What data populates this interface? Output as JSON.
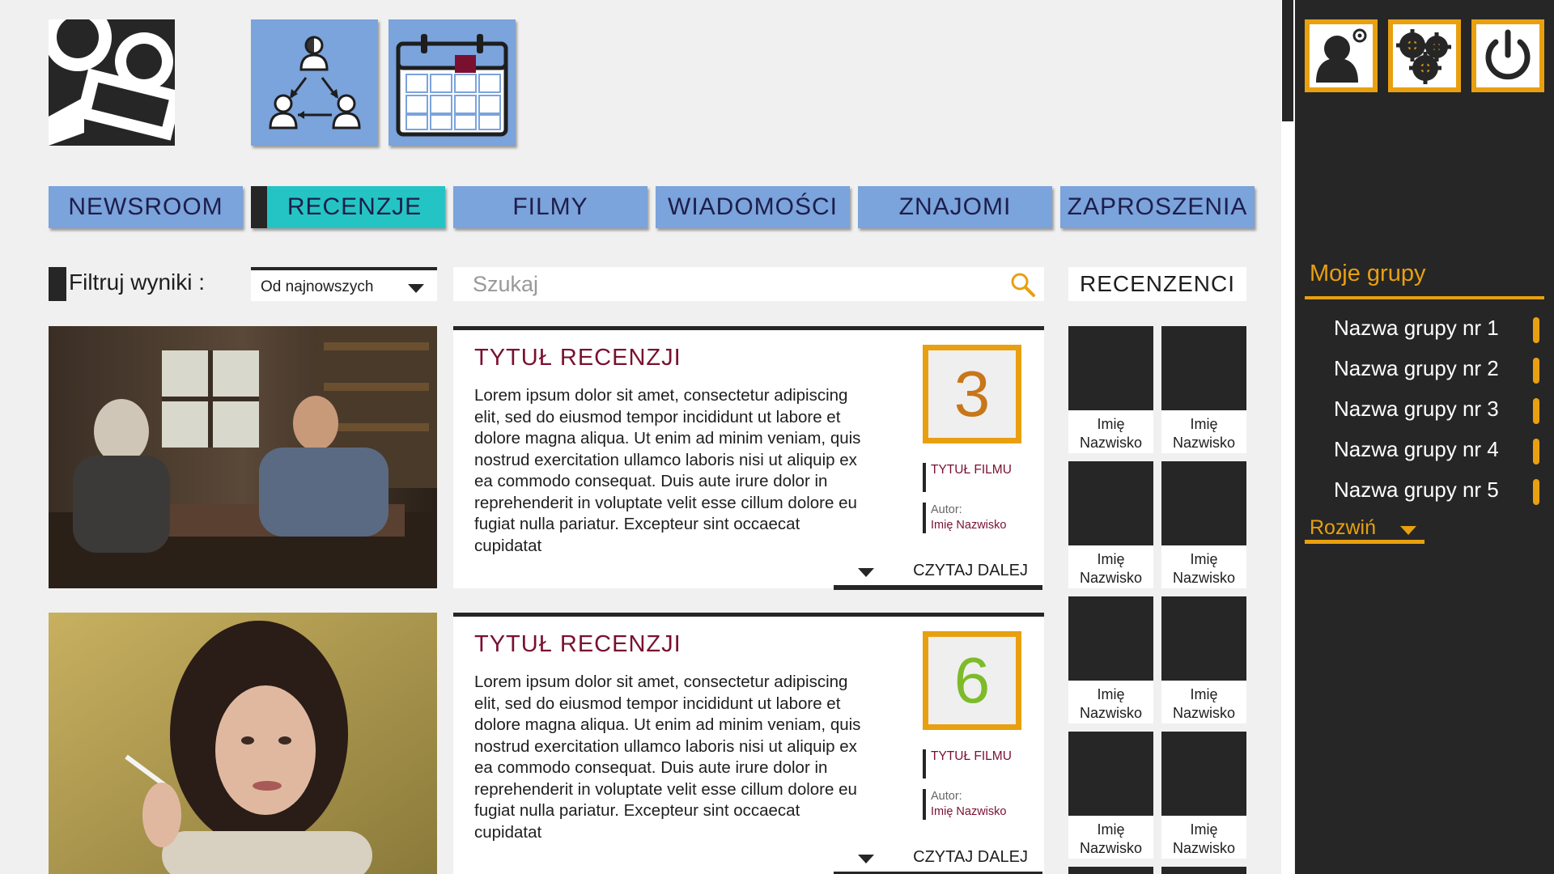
{
  "topbar": {
    "logo_icon": "film-camera-logo-icon",
    "friends_network_icon": "friends-network-icon",
    "calendar_icon": "calendar-icon"
  },
  "nav": {
    "items": [
      {
        "label": "NEWSROOM",
        "active": false
      },
      {
        "label": "RECENZJE",
        "active": true
      },
      {
        "label": "FILMY",
        "active": false
      },
      {
        "label": "WIADOMOŚCI",
        "active": false
      },
      {
        "label": "ZNAJOMI",
        "active": false
      },
      {
        "label": "ZAPROSZENIA",
        "active": false
      }
    ]
  },
  "filter": {
    "label": "Filtruj wyniki :",
    "selected": "Od najnowszych"
  },
  "search": {
    "placeholder": "Szukaj"
  },
  "reviewers": {
    "title": "RECENZENCI",
    "items": [
      {
        "first": "Imię",
        "last": "Nazwisko"
      },
      {
        "first": "Imię",
        "last": "Nazwisko"
      },
      {
        "first": "Imię",
        "last": "Nazwisko"
      },
      {
        "first": "Imię",
        "last": "Nazwisko"
      },
      {
        "first": "Imię",
        "last": "Nazwisko"
      },
      {
        "first": "Imię",
        "last": "Nazwisko"
      },
      {
        "first": "Imię",
        "last": "Nazwisko"
      },
      {
        "first": "Imię",
        "last": "Nazwisko"
      }
    ]
  },
  "reviews": [
    {
      "title": "TYTUŁ RECENZJI",
      "body": "Lorem ipsum dolor sit amet, consectetur adipiscing elit, sed do eiusmod tempor incididunt ut labore et dolore magna aliqua. Ut enim ad minim veniam, quis nostrud exercitation ullamco laboris nisi ut aliquip ex ea commodo consequat. Duis aute irure dolor in reprehenderit in voluptate velit esse cillum dolore eu fugiat nulla pariatur. Excepteur sint occaecat cupidatat",
      "score": "3",
      "score_color": "#c8761a",
      "film": "TYTUŁ FILMU",
      "author_label": "Autor:",
      "author": "Imię Nazwisko",
      "more": "CZYTAJ DALEJ"
    },
    {
      "title": "TYTUŁ RECENZJI",
      "body": "Lorem ipsum dolor sit amet, consectetur adipiscing elit, sed do eiusmod tempor incididunt ut labore et dolore magna aliqua. Ut enim ad minim veniam, quis nostrud exercitation ullamco laboris nisi ut aliquip ex ea commodo consequat. Duis aute irure dolor in reprehenderit in voluptate velit esse cillum dolore eu fugiat nulla pariatur. Excepteur sint occaecat cupidatat",
      "score": "6",
      "score_color": "#7dbb2a",
      "film": "TYTUŁ FILMU",
      "author_label": "Autor:",
      "author": "Imię Nazwisko",
      "more": "CZYTAJ DALEJ"
    }
  ],
  "panel": {
    "icons": [
      "user-settings-icon",
      "settings-gears-icon",
      "power-icon"
    ],
    "groups_title": "Moje grupy",
    "groups": [
      "Nazwa grupy nr 1",
      "Nazwa grupy nr 2",
      "Nazwa grupy nr 3",
      "Nazwa grupy nr 4",
      "Nazwa grupy nr 5"
    ],
    "expand_label": "Rozwiń"
  },
  "colors": {
    "accent_blue": "#7ba3dc",
    "active_teal": "#25c4c4",
    "accent_orange": "#e8a010",
    "title_maroon": "#7a1030",
    "dark": "#262626"
  }
}
